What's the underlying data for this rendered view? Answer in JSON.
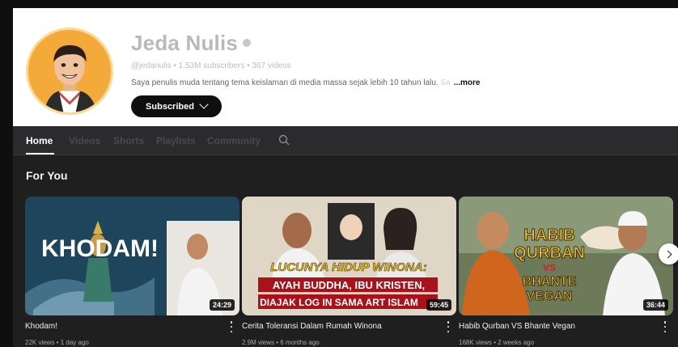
{
  "channel": {
    "name": "Jeda Nulis",
    "meta": "@jedanulis • 1.53M subscribers • 367 videos",
    "description": "Saya penulis muda tentang tema keislaman di media massa sejak lebih 10 tahun lalu.",
    "description_fade": " Sa",
    "more_label": "...more",
    "subscribe_label": "Subscribed"
  },
  "tabs": [
    {
      "label": "Home",
      "active": true
    },
    {
      "label": "Videos"
    },
    {
      "label": "Shorts"
    },
    {
      "label": "Playlists"
    },
    {
      "label": "Community"
    }
  ],
  "section": {
    "title": "For You"
  },
  "videos": [
    {
      "title": "Khodam!",
      "meta": "22K views • 1 day ago",
      "duration": "24:29",
      "thumb_text": [
        "KHODAM!"
      ]
    },
    {
      "title": "Cerita Toleransi Dalam Rumah Winona",
      "meta": "2.9M views • 6 months ago",
      "duration": "59:45",
      "thumb_text": [
        "LUCUNYA HIDUP WINONA:",
        "AYAH BUDDHA, IBU KRISTEN,",
        "DIAJAK LOG IN SAMA ART ISLAM"
      ]
    },
    {
      "title": "Habib Qurban VS Bhante Vegan",
      "meta": "168K views • 2 weeks ago",
      "duration": "36:44",
      "thumb_text": [
        "HABIB",
        "QURBAN",
        "VS",
        "BHANTE",
        "VEGAN"
      ]
    }
  ],
  "icons": {
    "verified": "verified-icon",
    "chevron": "chevron-down-icon",
    "search": "search-icon",
    "kebab": "more-vert-icon",
    "next": "chevron-right-icon"
  },
  "colors": {
    "accent": "#0f0f0f",
    "avatar_bg": "#f4a93b",
    "thumb_yellow": "#f6c61c"
  }
}
